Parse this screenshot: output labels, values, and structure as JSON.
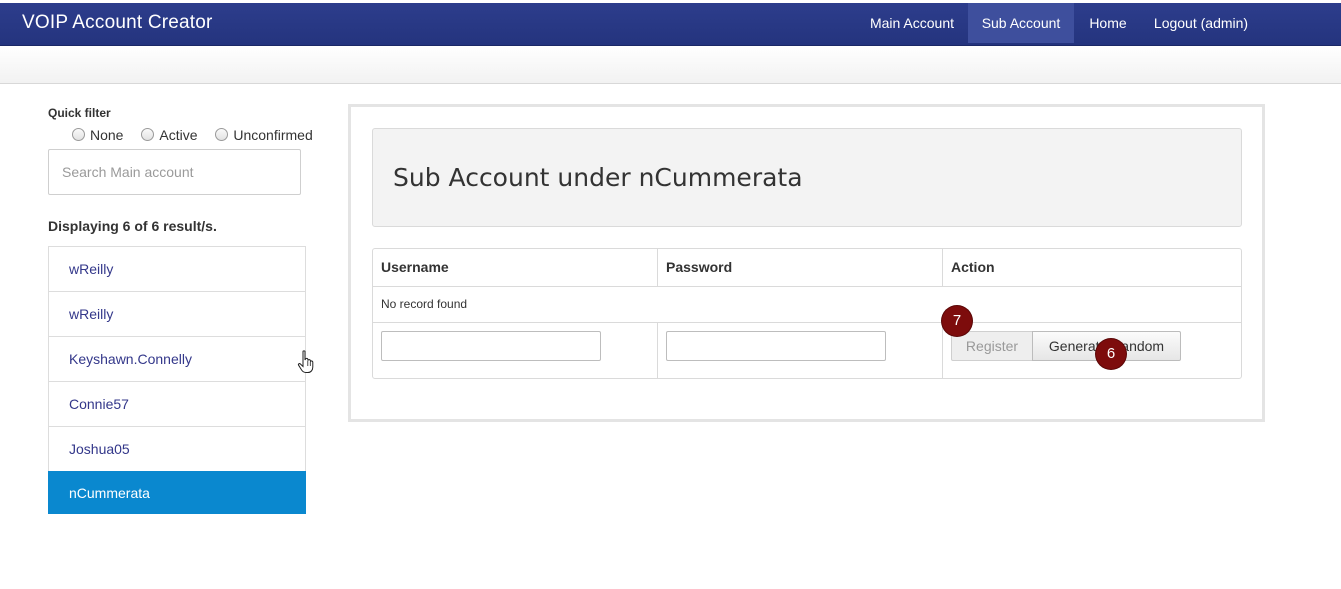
{
  "app": {
    "title": "VOIP Account Creator"
  },
  "nav": {
    "items": [
      {
        "label": "Main Account",
        "active": false
      },
      {
        "label": "Sub Account",
        "active": true
      },
      {
        "label": "Home",
        "active": false
      },
      {
        "label": "Logout (admin)",
        "active": false
      }
    ]
  },
  "sidebar": {
    "quick_filter_label": "Quick filter",
    "filters": [
      "None",
      "Active",
      "Unconfirmed"
    ],
    "search_placeholder": "Search Main account",
    "display_count": "Displaying 6 of 6 result/s.",
    "accounts": [
      {
        "name": "wReilly",
        "selected": false
      },
      {
        "name": "wReilly",
        "selected": false
      },
      {
        "name": "Keyshawn.Connelly",
        "selected": false
      },
      {
        "name": "Connie57",
        "selected": false
      },
      {
        "name": "Joshua05",
        "selected": false
      },
      {
        "name": "nCummerata",
        "selected": true
      }
    ]
  },
  "main": {
    "title": "Sub Account under nCummerata",
    "table": {
      "headers": [
        "Username",
        "Password",
        "Action"
      ],
      "empty_text": "No record found"
    },
    "register_label": "Register",
    "generate_label": "Generate Random",
    "badges": [
      "7",
      "6"
    ]
  },
  "colors": {
    "navbar": "#2d3d8c",
    "selected_item": "#0a88cf",
    "badge": "#7d0c0c"
  }
}
